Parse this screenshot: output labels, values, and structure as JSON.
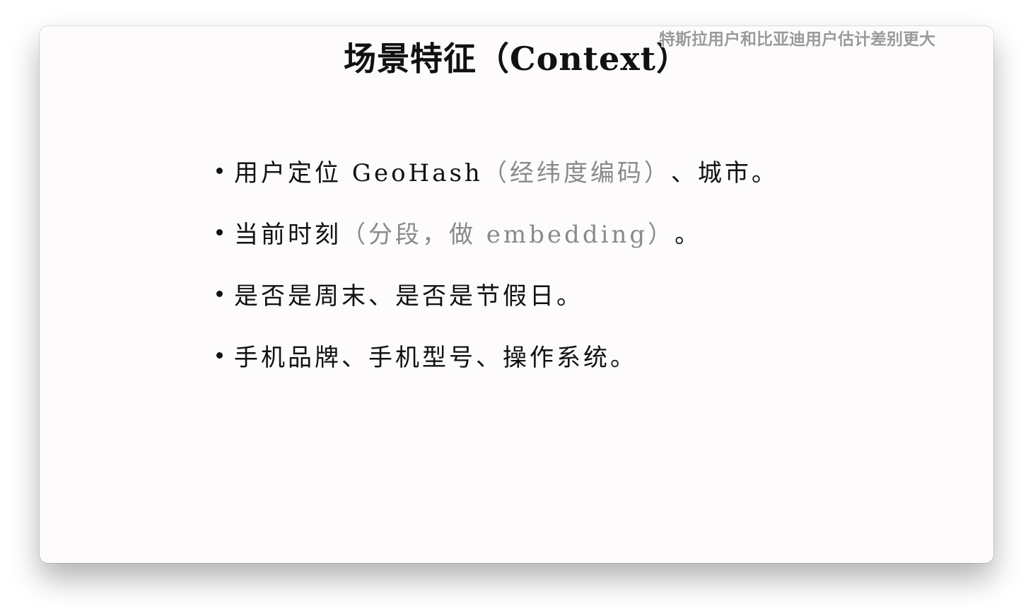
{
  "slide": {
    "title": "场景特征（Context）",
    "subtitle_overlay": "特斯拉用户和比亚迪用户估计差别更大",
    "bullets": [
      {
        "main": "用户定位 GeoHash",
        "note": "（经纬度编码）",
        "tail": "、城市。"
      },
      {
        "main": "当前时刻",
        "note": "（分段，做 embedding）",
        "tail": "。"
      },
      {
        "main": "是否是周末、是否是节假日。",
        "note": "",
        "tail": ""
      },
      {
        "main": "手机品牌、手机型号、操作系统。",
        "note": "",
        "tail": ""
      }
    ]
  },
  "colors": {
    "background": "#fdfbfb",
    "text": "#111111",
    "muted_text": "#8a8a8a",
    "overlay_text": "#9a9a9a"
  }
}
